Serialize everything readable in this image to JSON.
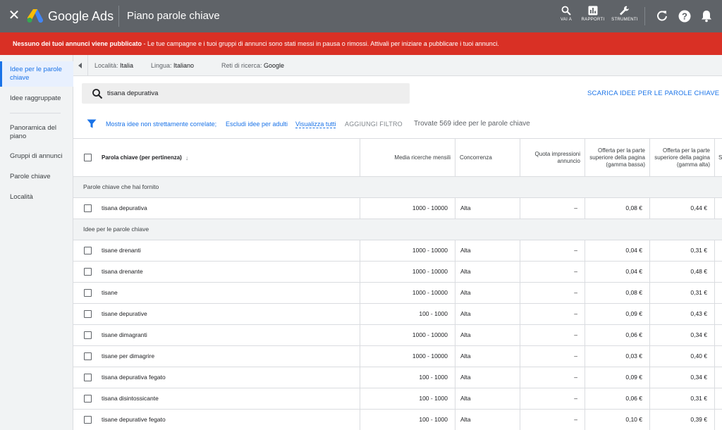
{
  "topbar": {
    "brand": "Google Ads",
    "page_title": "Piano parole chiave",
    "buttons": [
      {
        "label": "VAI A",
        "icon": "search-icon"
      },
      {
        "label": "RAPPORTI",
        "icon": "bar-chart-icon"
      },
      {
        "label": "STRUMENTI",
        "icon": "wrench-icon"
      }
    ],
    "icons": [
      "refresh-icon",
      "help-icon",
      "notifications-icon"
    ],
    "colors": {
      "bar": "#5f6368",
      "alert": "#d93025",
      "accent": "#1a73e8"
    }
  },
  "alert": {
    "bold": "Nessuno dei tuoi annunci viene pubblicato",
    "text": " - Le tue campagne e i tuoi gruppi di annunci sono stati messi in pausa o rimossi. Attivali per iniziare a pubblicare i tuoi annunci."
  },
  "sidebar": {
    "items": [
      {
        "label": "Idee per le parole chiave",
        "active": true
      },
      {
        "label": "Idee raggruppate",
        "active": false
      },
      {
        "label": "Panoramica del piano",
        "active": false
      },
      {
        "label": "Gruppi di annunci",
        "active": false
      },
      {
        "label": "Parole chiave",
        "active": false
      },
      {
        "label": "Località",
        "active": false
      }
    ]
  },
  "locbar": {
    "location_label": "Località: ",
    "location_value": "Italia",
    "language_label": "Lingua: ",
    "language_value": "Italiano",
    "network_label": "Reti di ricerca: ",
    "network_value": "Google"
  },
  "search": {
    "value": "tisana depurativa",
    "download_label": "SCARICA IDEE PER LE PAROLE CHIAVE"
  },
  "filters": {
    "link1": "Mostra idee non strettamente correlate;",
    "link2": "Escludi idee per adulti",
    "link3": "Visualizza tutti",
    "add_filter": "AGGIUNGI FILTRO",
    "found": "Trovate 569 idee per le parole chiave"
  },
  "table": {
    "headers": {
      "keyword": "Parola chiave (per pertinenza)",
      "searches": "Media ricerche mensili",
      "competition": "Concorrenza",
      "impression_share": "Quota impressioni annuncio",
      "bid_low": "Offerta per la parte superiore della pagina (gamma bassa)",
      "bid_high": "Offerta per la parte superiore della pagina (gamma alta)",
      "cut": "S"
    },
    "group_provided": "Parole chiave che hai fornito",
    "group_ideas": "Idee per le parole chiave",
    "provided": [
      {
        "keyword": "tisana depurativa",
        "searches": "1000 - 10000",
        "competition": "Alta",
        "share": "–",
        "low": "0,08 €",
        "high": "0,44 €"
      }
    ],
    "ideas": [
      {
        "keyword": "tisane drenanti",
        "searches": "1000 - 10000",
        "competition": "Alta",
        "share": "–",
        "low": "0,04 €",
        "high": "0,31 €"
      },
      {
        "keyword": "tisana drenante",
        "searches": "1000 - 10000",
        "competition": "Alta",
        "share": "–",
        "low": "0,04 €",
        "high": "0,48 €"
      },
      {
        "keyword": "tisane",
        "searches": "1000 - 10000",
        "competition": "Alta",
        "share": "–",
        "low": "0,08 €",
        "high": "0,31 €"
      },
      {
        "keyword": "tisane depurative",
        "searches": "100 - 1000",
        "competition": "Alta",
        "share": "–",
        "low": "0,09 €",
        "high": "0,43 €"
      },
      {
        "keyword": "tisane dimagranti",
        "searches": "1000 - 10000",
        "competition": "Alta",
        "share": "–",
        "low": "0,06 €",
        "high": "0,34 €"
      },
      {
        "keyword": "tisane per dimagrire",
        "searches": "1000 - 10000",
        "competition": "Alta",
        "share": "–",
        "low": "0,03 €",
        "high": "0,40 €"
      },
      {
        "keyword": "tisana depurativa fegato",
        "searches": "100 - 1000",
        "competition": "Alta",
        "share": "–",
        "low": "0,09 €",
        "high": "0,34 €"
      },
      {
        "keyword": "tisana disintossicante",
        "searches": "100 - 1000",
        "competition": "Alta",
        "share": "–",
        "low": "0,06 €",
        "high": "0,31 €"
      },
      {
        "keyword": "tisane depurative fegato",
        "searches": "100 - 1000",
        "competition": "Alta",
        "share": "–",
        "low": "0,10 €",
        "high": "0,39 €"
      }
    ]
  }
}
